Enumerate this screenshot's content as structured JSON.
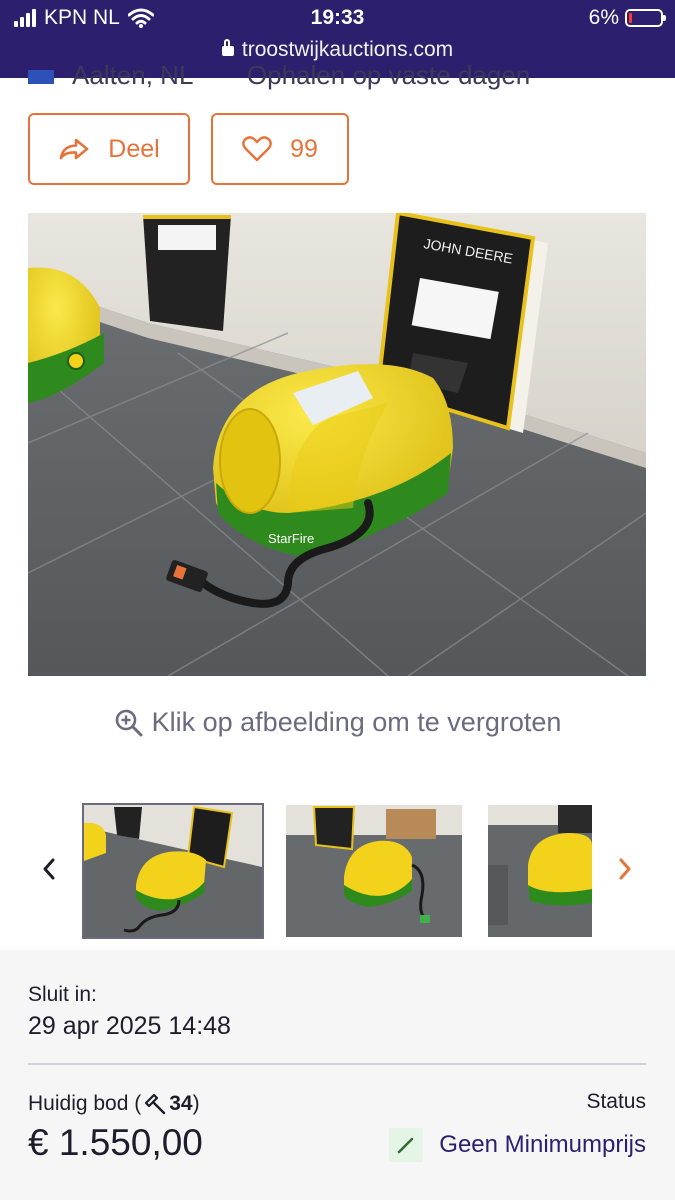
{
  "status_bar": {
    "carrier": "KPN NL",
    "time": "19:33",
    "battery": "6%",
    "url": "troostwijkauctions.com"
  },
  "header_cut": {
    "location": "Aalten, NL",
    "pickup": "Ophalen op vaste dagen"
  },
  "actions": {
    "share_label": "Deel",
    "favorite_count": "99"
  },
  "image_hint": "Klik op afbeelding om te vergroten",
  "closing": {
    "label": "Sluit in:",
    "date": "29 apr 2025 14:48"
  },
  "bid": {
    "label_prefix": "Huidig bod (",
    "count": "34",
    "label_suffix": ")",
    "amount": "€ 1.550,00"
  },
  "status": {
    "label": "Status",
    "value": "Geen Minimumprijs"
  },
  "colors": {
    "brand_navy": "#2b1f6e",
    "accent_orange": "#e8733a",
    "jd_yellow": "#f2d21a",
    "jd_green": "#2f8a1e"
  }
}
